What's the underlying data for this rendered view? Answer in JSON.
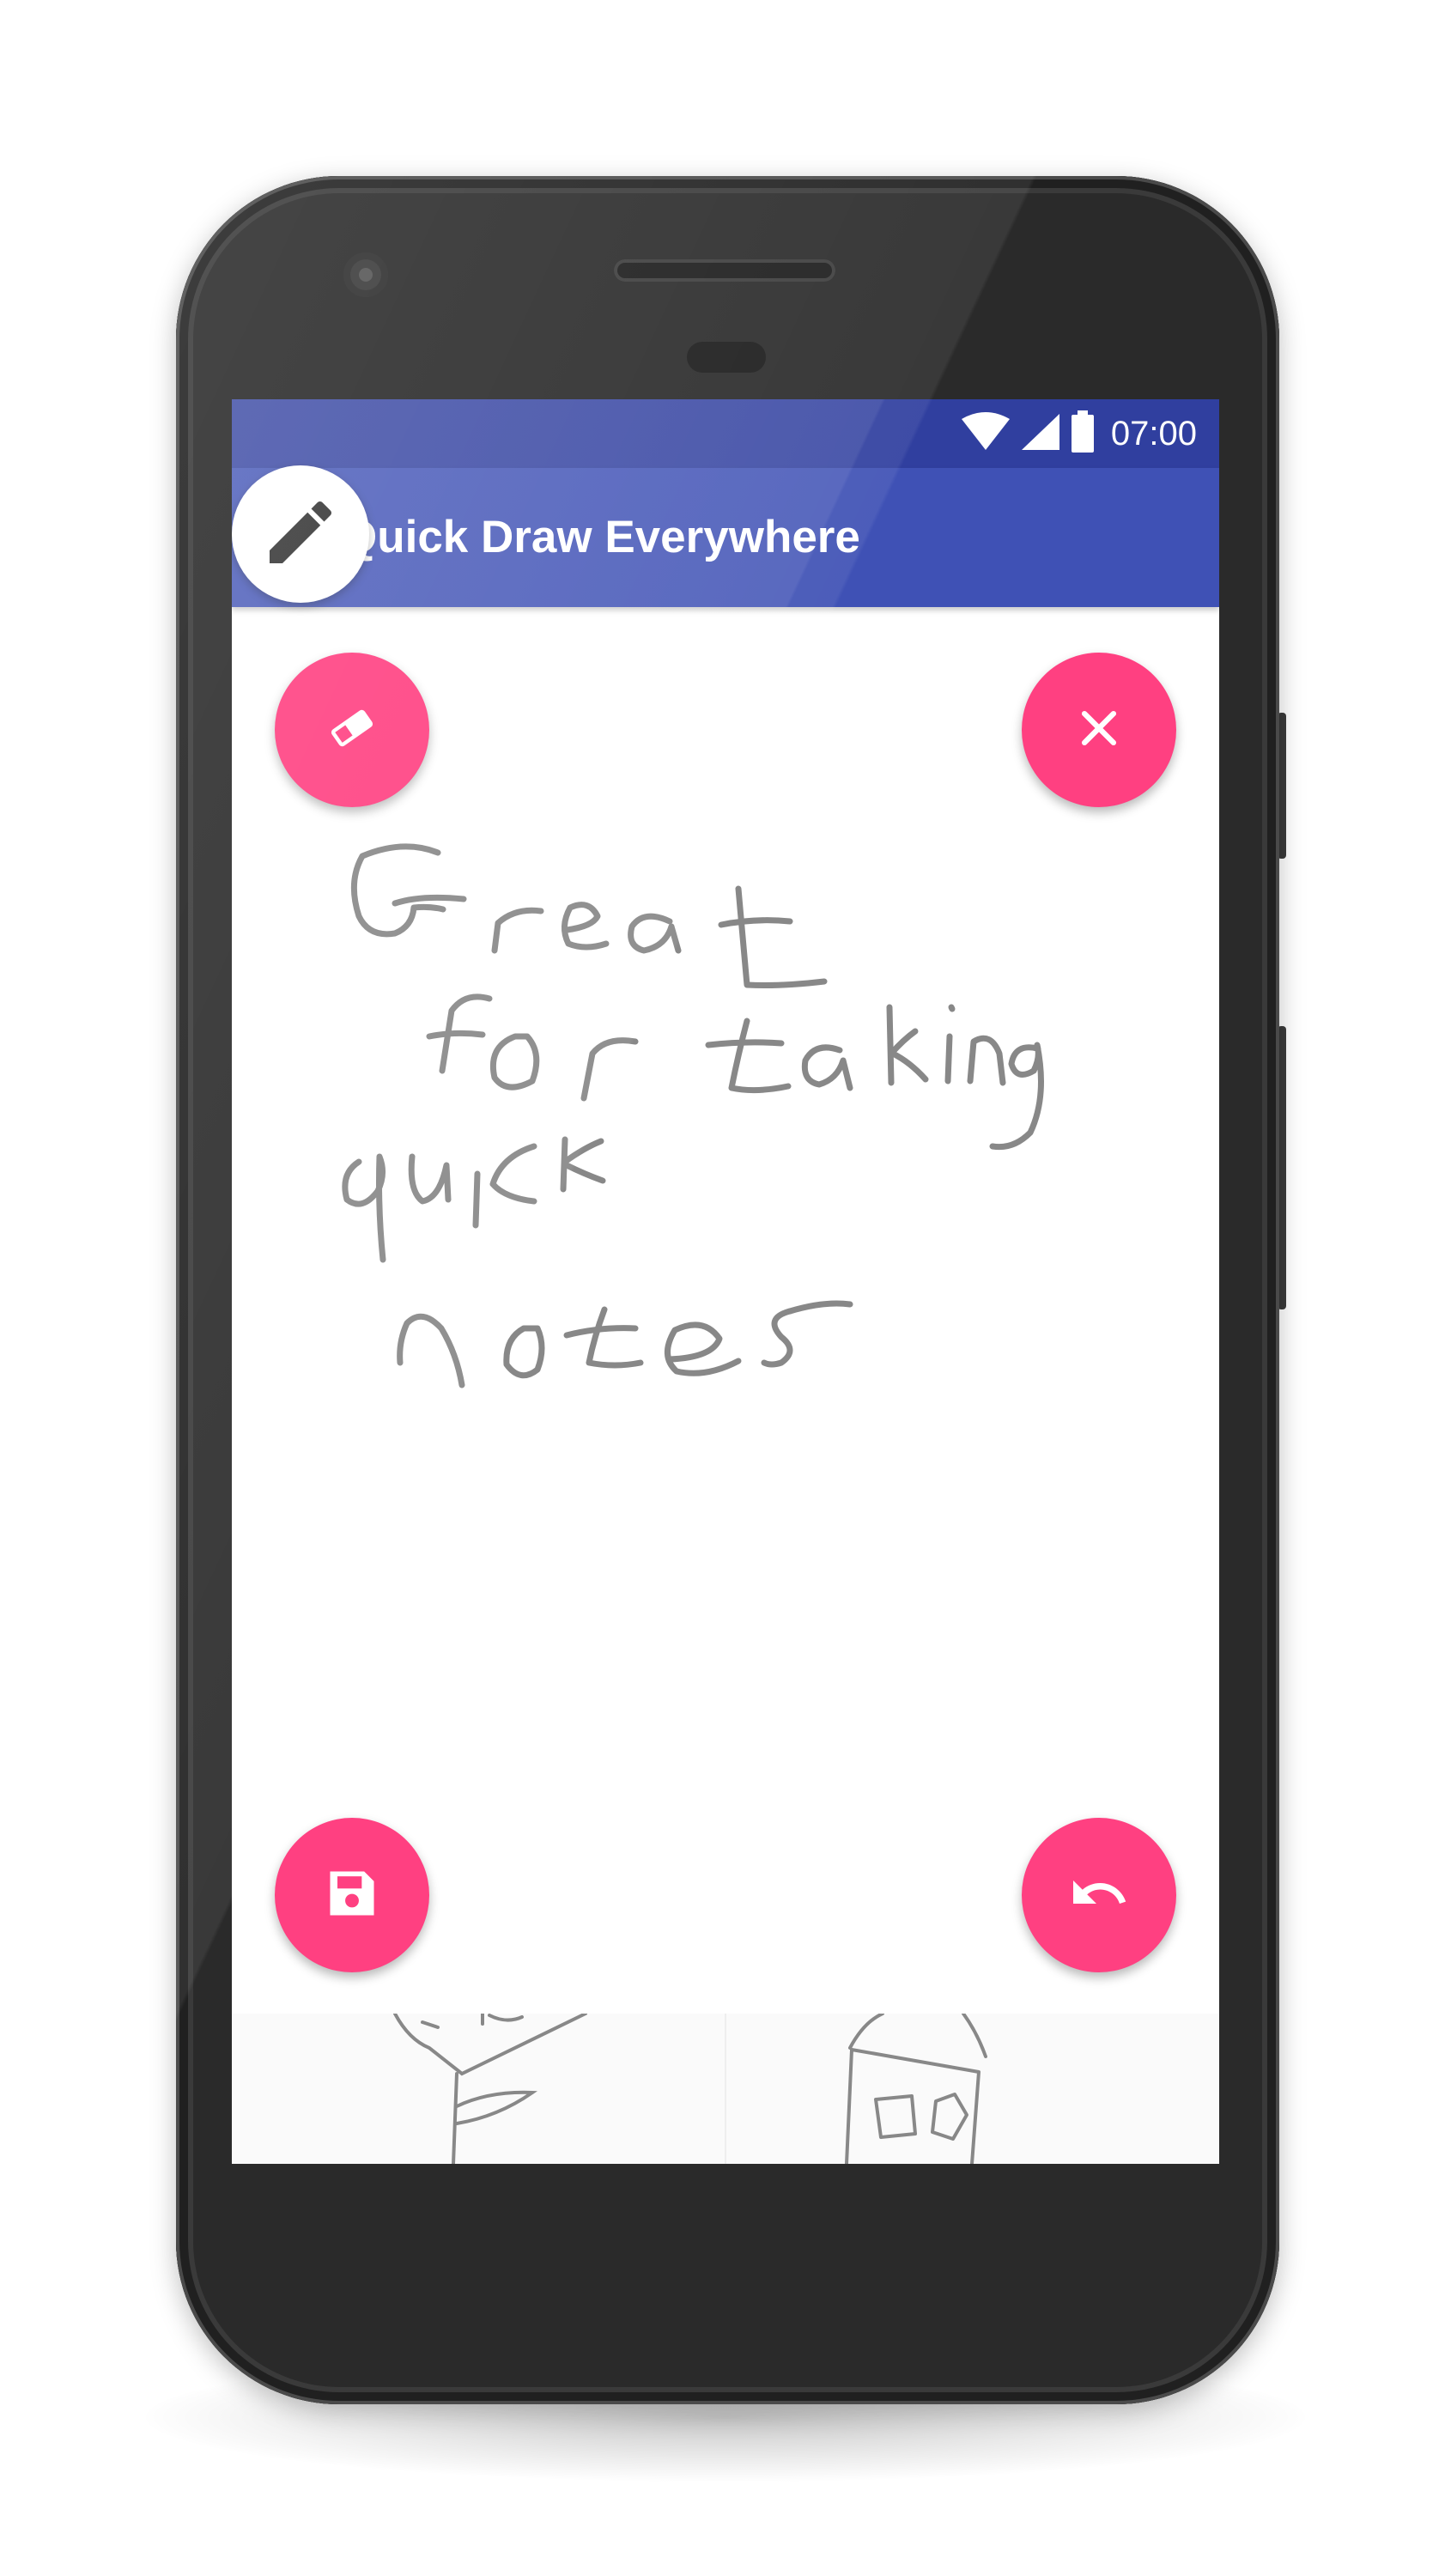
{
  "status_bar": {
    "time": "07:00",
    "icons": [
      "wifi-icon",
      "cell-signal-icon",
      "battery-icon"
    ],
    "color": "#303F9F"
  },
  "app_bar": {
    "title": "Quick Draw Everywhere",
    "color": "#3F51B5",
    "bubble_icon": "pencil-icon"
  },
  "canvas": {
    "handwritten_text": [
      "Great",
      "for taking",
      "quick",
      "notes"
    ],
    "stroke_color": "#888888"
  },
  "fabs": {
    "color": "#FF4081",
    "eraser": "eraser-icon",
    "close": "close-icon",
    "save": "save-icon",
    "undo": "undo-icon"
  },
  "thumbnails": [
    "tree-sketch",
    "house-sketch"
  ]
}
